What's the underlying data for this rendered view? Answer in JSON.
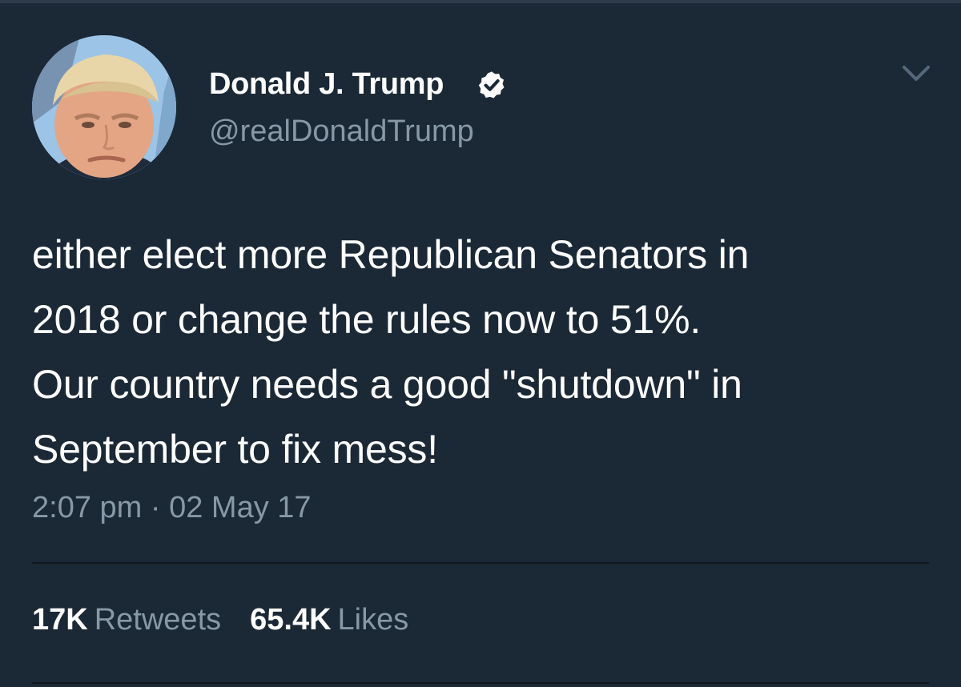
{
  "tweet": {
    "author_name": "Donald J. Trump",
    "handle": "@realDonaldTrump",
    "verified": true,
    "text_lines": [
      "either elect more Republican Senators in",
      "2018 or change the rules now to 51%.",
      "Our country needs a good \"shutdown\" in",
      "September to fix mess!"
    ],
    "time": "2:07 pm",
    "separator": "·",
    "date": "02 May 17",
    "retweets": {
      "count": "17K",
      "label": "Retweets"
    },
    "likes": {
      "count": "65.4K",
      "label": "Likes"
    }
  },
  "icons": {
    "verified": "verified-badge-icon",
    "menu": "chevron-down-icon"
  },
  "colors": {
    "background": "#1b2836",
    "primary_text": "#ffffff",
    "secondary_text": "#8899a6",
    "divider": "#10171e"
  }
}
